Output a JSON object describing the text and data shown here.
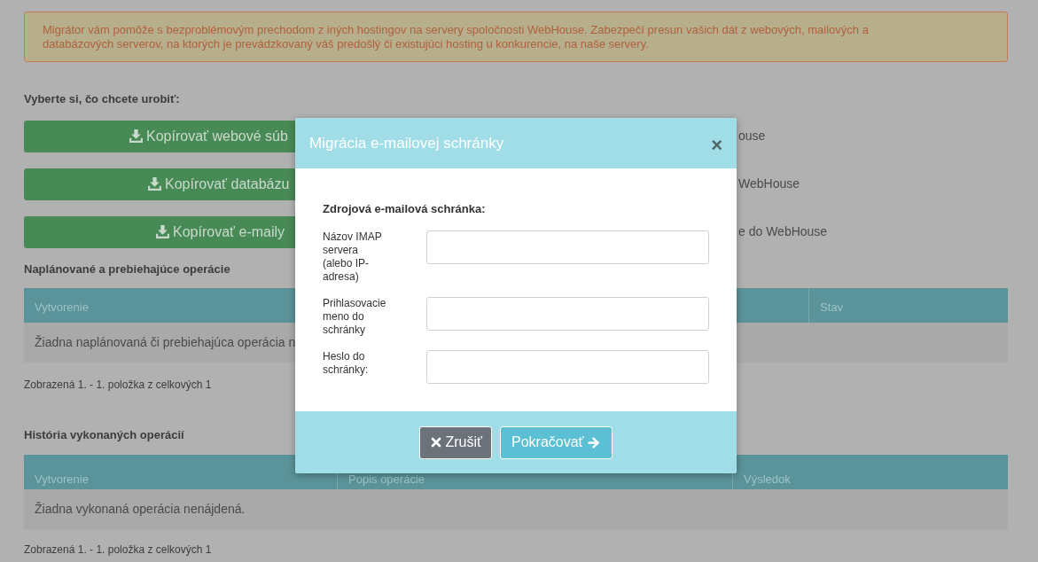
{
  "alert": {
    "text": "Migrátor vám pomôže s bezproblémovým prechodom z iných hostingov na servery spoločnosti WebHouse. Zabezpečí presun vašich dát z webových, mailových a databázových serverov, na ktorých je prevádzkovaný váš predošlý či existujúci hosting u konkurencie, na naše servery."
  },
  "actions_heading": "Vyberte si, čo chcete urobiť:",
  "actions": [
    {
      "label": "Kopírovať webové súb",
      "description": "ouse"
    },
    {
      "label": "Kopírovať databázu",
      "description": "WebHouse"
    },
    {
      "label": "Kopírovať e-maily",
      "description": "e do WebHouse"
    }
  ],
  "scheduled": {
    "heading": "Naplánované a prebiehajúce operácie",
    "columns": [
      "Vytvorenie",
      "Stav"
    ],
    "empty": "Žiadna naplánovaná či prebiehajúca operácia n",
    "pager": "Zobrazená 1. - 1. položka z celkových 1"
  },
  "history": {
    "heading": "História vykonaných operácií",
    "columns": [
      "Vytvorenie",
      "Popis operácie",
      "Výsledok"
    ],
    "empty": "Žiadna vykonaná operácia nenájdená.",
    "pager": "Zobrazená 1. - 1. položka z celkových 1"
  },
  "modal": {
    "title": "Migrácia e-mailovej schránky",
    "close": "×",
    "section": "Zdrojová e-mailová schránka:",
    "fields": [
      {
        "label": "Názov IMAP servera (alebo IP-adresa)"
      },
      {
        "label": "Prihlasovacie meno do schránky"
      },
      {
        "label": "Heslo do schránky:"
      }
    ],
    "cancel": "Zrušiť",
    "continue": "Pokračovať"
  }
}
